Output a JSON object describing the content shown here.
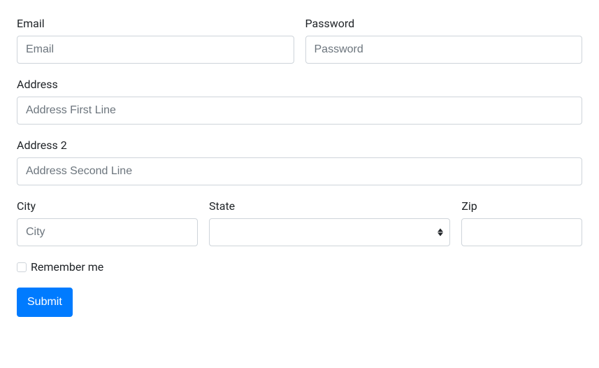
{
  "form": {
    "email": {
      "label": "Email",
      "placeholder": "Email",
      "value": ""
    },
    "password": {
      "label": "Password",
      "placeholder": "Password",
      "value": ""
    },
    "address": {
      "label": "Address",
      "placeholder": "Address First Line",
      "value": ""
    },
    "address2": {
      "label": "Address 2",
      "placeholder": "Address Second Line",
      "value": ""
    },
    "city": {
      "label": "City",
      "placeholder": "City",
      "value": ""
    },
    "state": {
      "label": "State",
      "value": ""
    },
    "zip": {
      "label": "Zip",
      "value": ""
    },
    "remember": {
      "label": "Remember me",
      "checked": false
    },
    "submit": {
      "label": "Submit"
    }
  }
}
